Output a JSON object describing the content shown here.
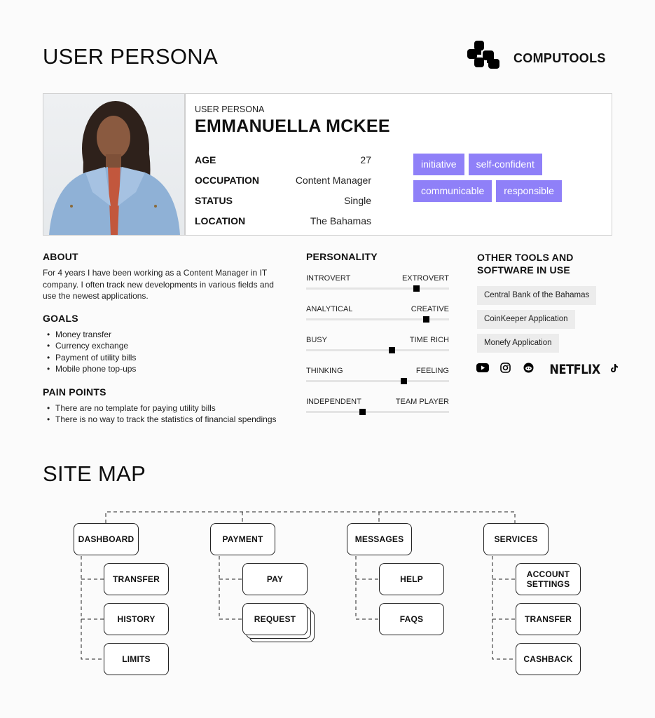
{
  "header": {
    "title": "USER PERSONA",
    "brand": "COMPUTOOLS"
  },
  "persona": {
    "label": "USER PERSONA",
    "name": "EMMANUELLA MCKEE",
    "details": [
      {
        "key": "AGE",
        "value": "27"
      },
      {
        "key": "OCCUPATION",
        "value": "Content Manager"
      },
      {
        "key": "STATUS",
        "value": "Single"
      },
      {
        "key": "LOCATION",
        "value": "The Bahamas"
      }
    ],
    "traits": [
      "initiative",
      "self-confident",
      "communicable",
      "responsible"
    ],
    "trait_color": "#8f80f8"
  },
  "about": {
    "title": "ABOUT",
    "text": "For 4 years I have been working as a Content Manager in IT company. I often track new developments in various fields and use the newest applications."
  },
  "goals": {
    "title": "GOALS",
    "items": [
      "Money transfer",
      "Currency exchange",
      "Payment of utility bills",
      "Mobile phone top-ups"
    ]
  },
  "pain_points": {
    "title": "PAIN POINTS",
    "items": [
      "There are no template for paying utility bills",
      "There is no way to track the statistics of financial spendings"
    ]
  },
  "personality": {
    "title": "PERSONALITY",
    "scales": [
      {
        "left": "INTROVERT",
        "right": "EXTROVERT",
        "value": 0.77
      },
      {
        "left": "ANALYTICAL",
        "right": "CREATIVE",
        "value": 0.84
      },
      {
        "left": "BUSY",
        "right": "TIME RICH",
        "value": 0.6
      },
      {
        "left": "THINKING",
        "right": "FEELING",
        "value": 0.68
      },
      {
        "left": "INDEPENDENT",
        "right": "TEAM PLAYER",
        "value": 0.39
      }
    ]
  },
  "tools": {
    "title_line1": "OTHER TOOLS AND",
    "title_line2": "SOFTWARE IN USE",
    "items": [
      "Central Bank of the Bahamas",
      "CoinKeeper Application",
      "Monefy Application"
    ],
    "social": [
      "youtube-icon",
      "instagram-icon",
      "reddit-icon",
      "netflix-logo",
      "tiktok-icon"
    ],
    "netflix_text": "NETFLIX"
  },
  "sitemap": {
    "title": "SITE MAP",
    "sections": [
      {
        "label": "DASHBOARD",
        "children": [
          "TRANSFER",
          "HISTORY",
          "LIMITS"
        ]
      },
      {
        "label": "PAYMENT",
        "children": [
          "PAY",
          "REQUEST"
        ]
      },
      {
        "label": "MESSAGES",
        "children": [
          "HELP",
          "FAQS"
        ]
      },
      {
        "label": "SERVICES",
        "children": [
          "ACCOUNT SETTINGS",
          "TRANSFER",
          "CASHBACK"
        ]
      }
    ]
  }
}
